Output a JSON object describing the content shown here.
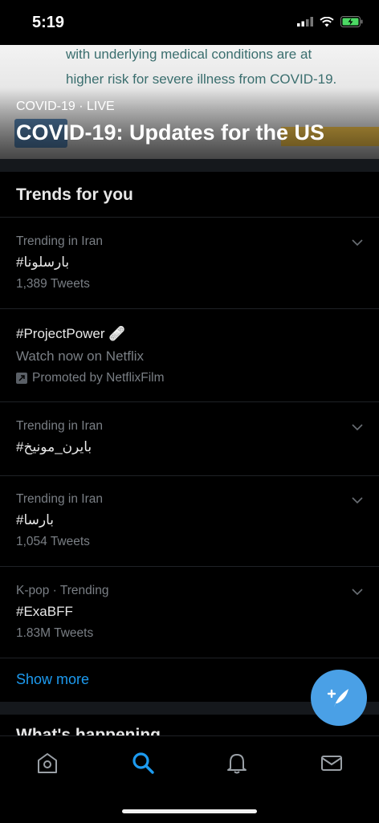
{
  "status": {
    "time": "5:19"
  },
  "hero": {
    "image_text_1": "with underlying medical conditions are at",
    "image_text_2": "higher risk for severe illness from COVID-19.",
    "meta": "COVID-19 · LIVE",
    "title": "COVID-19: Updates for the US"
  },
  "trends": {
    "heading": "Trends for you",
    "items": [
      {
        "context": "Trending in Iran",
        "name": "#بارسلونا",
        "count": "1,389 Tweets"
      },
      {
        "name": "#ProjectPower 🩹",
        "line2": "Watch now on Netflix",
        "promoted": "Promoted by NetflixFilm"
      },
      {
        "context": "Trending in Iran",
        "name": "#بايرن_مونيخ"
      },
      {
        "context": "Trending in Iran",
        "name": "#بارسا",
        "count": "1,054 Tweets"
      },
      {
        "context": "K-pop · Trending",
        "name": "#ExaBFF",
        "count": "1.83M Tweets"
      }
    ],
    "show_more": "Show more"
  },
  "next_section": {
    "heading": "What's happening"
  },
  "colors": {
    "accent": "#1d9bf0",
    "fab": "#4aa0e6",
    "background": "#000000"
  },
  "icons": {
    "tabs": [
      "home-icon",
      "search-icon",
      "notifications-icon",
      "messages-icon"
    ],
    "fab": "compose-tweet-icon"
  }
}
